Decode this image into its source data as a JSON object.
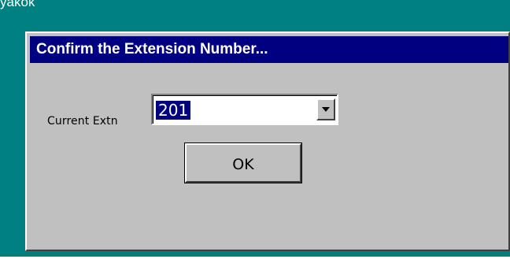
{
  "background_window": {
    "title": "yakok"
  },
  "dialog": {
    "title": "Confirm the Extension Number...",
    "label": "Current Extn",
    "extension": {
      "value": "201",
      "dropdown_icon": "chevron-down-icon"
    },
    "ok_label": "OK"
  },
  "colors": {
    "desktop_teal": "#008080",
    "titlebar_blue": "#000080",
    "dialog_gray": "#c0c0c0",
    "selection_blue": "#000080"
  }
}
